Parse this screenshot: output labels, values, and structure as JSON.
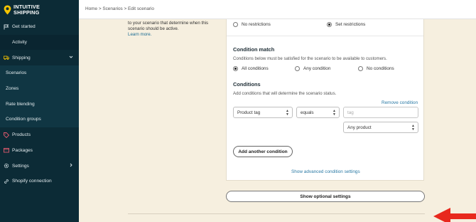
{
  "brand": {
    "name_line1": "INTUITIVE",
    "name_line2": "SHIPPING",
    "accent": "#f5c400"
  },
  "sidebar": {
    "items": [
      {
        "label": "Get started"
      },
      {
        "label": "Activity"
      },
      {
        "label": "Shipping"
      },
      {
        "label": "Scenarios"
      },
      {
        "label": "Zones"
      },
      {
        "label": "Rate blending"
      },
      {
        "label": "Condition groups"
      },
      {
        "label": "Products"
      },
      {
        "label": "Packages"
      },
      {
        "label": "Settings"
      },
      {
        "label": "Shopify connection"
      }
    ]
  },
  "breadcrumb": {
    "text": "Home > Scenarios > Edit scenario"
  },
  "left_description": {
    "text": "to your scenario that determine when this scenario should be active.",
    "link": "Learn more."
  },
  "restrictions": {
    "options": [
      {
        "label": "No restrictions",
        "selected": false
      },
      {
        "label": "Set restrictions",
        "selected": true
      }
    ]
  },
  "condition_match": {
    "title": "Condition match",
    "description": "Conditions below must be satisfied for the scenario to be available to customers.",
    "options": [
      {
        "label": "All conditions",
        "selected": true
      },
      {
        "label": "Any condition",
        "selected": false
      },
      {
        "label": "No conditions",
        "selected": false
      }
    ]
  },
  "conditions": {
    "title": "Conditions",
    "description": "Add conditions that will determine the scenario status.",
    "remove_label": "Remove condition",
    "field_value": "Product tag",
    "operator_value": "equals",
    "tag_placeholder": "tag",
    "product_value": "Any product",
    "add_button": "Add another condition",
    "advanced_link": "Show advanced condition settings"
  },
  "optional_button": "Show optional settings",
  "colors": {
    "sidebar_bg": "#0c2b36",
    "page_bg": "#f6efdf",
    "link": "#2b7aa5",
    "arrow": "#e8281d"
  }
}
